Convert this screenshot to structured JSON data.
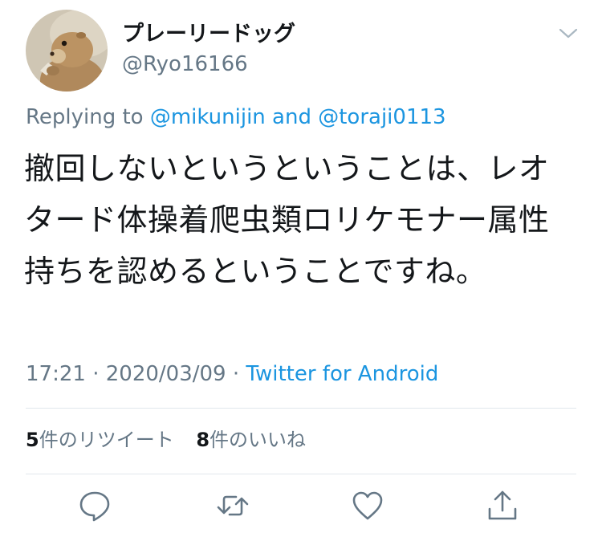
{
  "author": {
    "display_name": "プレーリードッグ",
    "handle": "@Ryo16166",
    "avatar_icon": "prairie-dog-avatar"
  },
  "menu_icon": "chevron-down-icon",
  "reply_context": {
    "prefix": "Replying to",
    "mention_1": "@mikunijin",
    "conjunction": "and",
    "mention_2": "@toraji0113"
  },
  "tweet": {
    "text": "撤回しないというということは、レオタード体操着爬虫類ロリケモナー属性持ちを認めるということですね。"
  },
  "meta": {
    "time": "17:21",
    "separator": "·",
    "date": "2020/03/09",
    "source": "Twitter for Android"
  },
  "stats": {
    "retweets_count": "5",
    "retweets_label": "件のリツイート",
    "likes_count": "8",
    "likes_label": "件のいいね"
  },
  "actions": [
    {
      "name": "reply",
      "icon": "reply-icon"
    },
    {
      "name": "retweet",
      "icon": "retweet-icon"
    },
    {
      "name": "like",
      "icon": "heart-icon"
    },
    {
      "name": "share",
      "icon": "share-icon"
    }
  ],
  "colors": {
    "text": "#14171a",
    "secondary": "#657786",
    "link": "#1b95e0",
    "divider": "#e1e8ed"
  }
}
